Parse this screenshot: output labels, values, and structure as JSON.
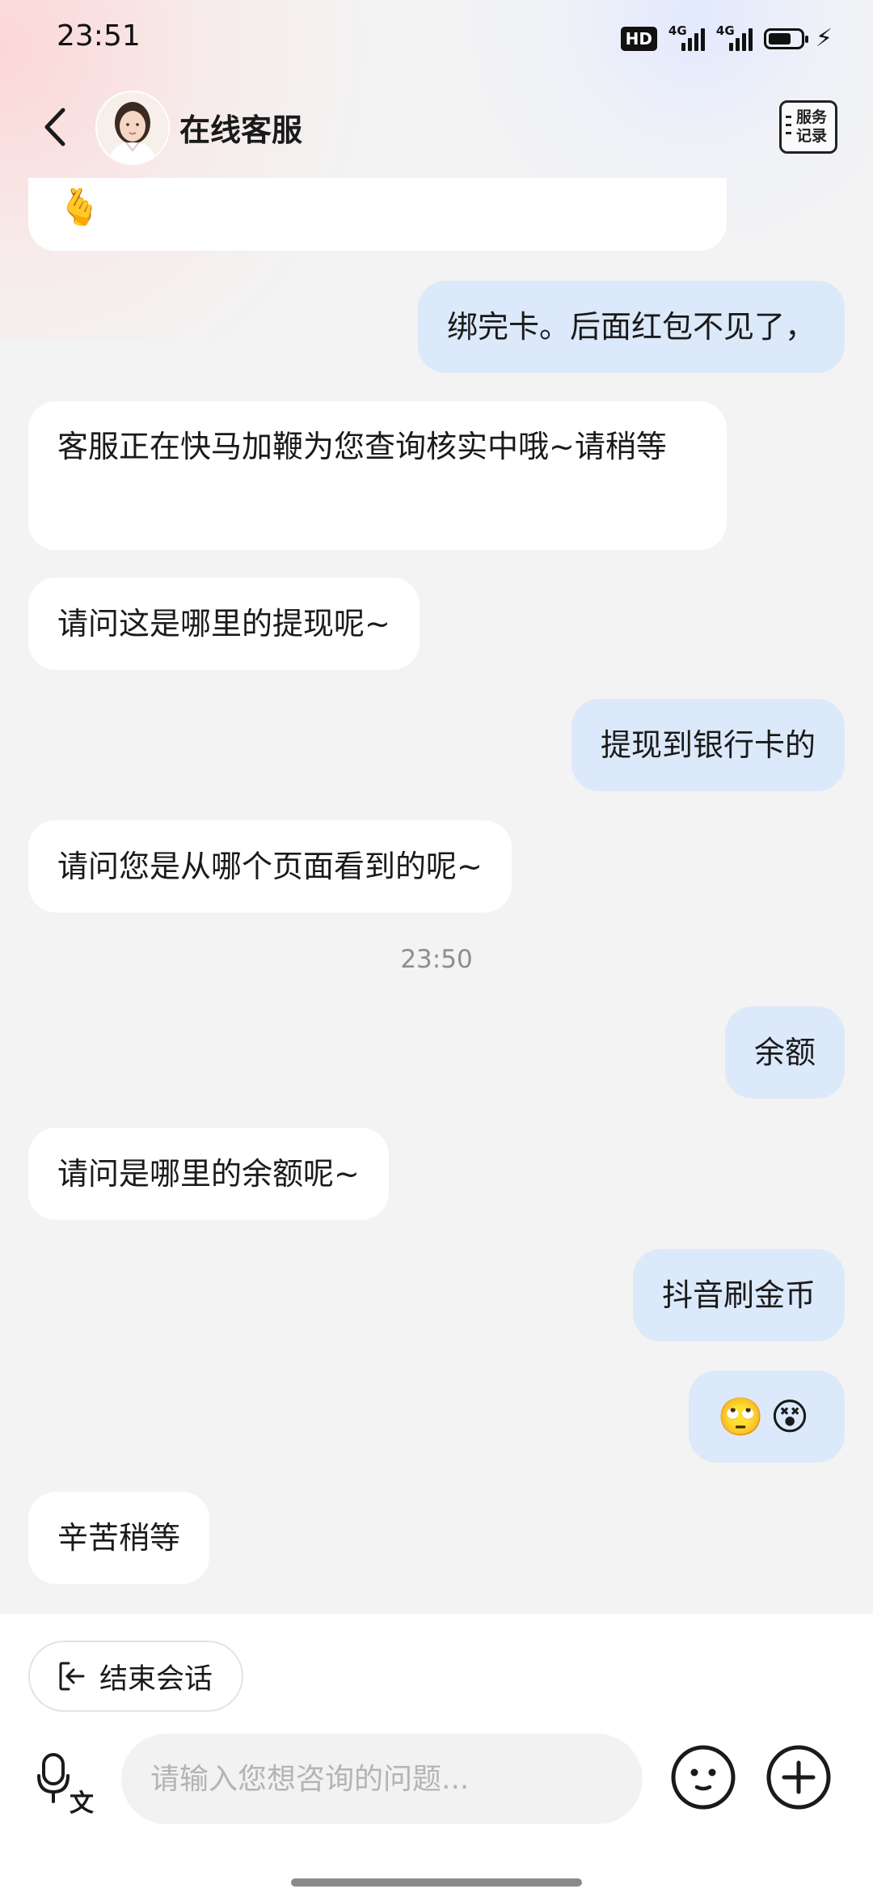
{
  "status_bar": {
    "time": "23:51",
    "hd_label": "HD",
    "network_1": "4G",
    "network_2": "4G",
    "battery_percent": 62
  },
  "header": {
    "title": "在线客服",
    "service_record_line1": "服务",
    "service_record_line2": "记录"
  },
  "messages": [
    {
      "side": "in",
      "text": "🫰",
      "kind": "emoji-partial"
    },
    {
      "side": "out",
      "text": "绑完卡。后面红包不见了，"
    },
    {
      "side": "in",
      "text": "客服正在快马加鞭为您查询核实中哦~请稍等"
    },
    {
      "side": "in",
      "text": "请问这是哪里的提现呢~"
    },
    {
      "side": "out",
      "text": "提现到银行卡的"
    },
    {
      "side": "in",
      "text": "请问您是从哪个页面看到的呢~"
    },
    {
      "kind": "timestamp",
      "text": "23:50"
    },
    {
      "side": "out",
      "text": "余额"
    },
    {
      "side": "in",
      "text": "请问是哪里的余额呢~"
    },
    {
      "side": "out",
      "text": "抖音刷金币"
    },
    {
      "side": "out",
      "text": "🙄😵",
      "kind": "emoji"
    },
    {
      "side": "in",
      "text": "辛苦稍等"
    }
  ],
  "footer": {
    "end_session_label": "结束会话",
    "input_placeholder": "请输入您想咨询的问题...",
    "input_value": ""
  },
  "colors": {
    "incoming_bubble": "#ffffff",
    "outgoing_bubble": "#dce9fb",
    "chat_background": "#f3f3f3"
  }
}
